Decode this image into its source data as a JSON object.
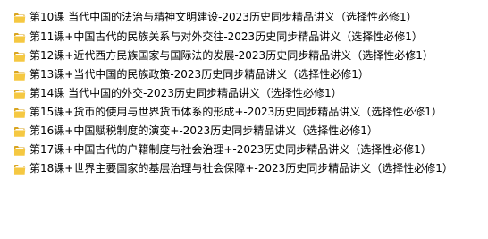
{
  "items": [
    {
      "name": "第10课 当代中国的法治与精神文明建设-2023历史同步精品讲义（选择性必修1）",
      "icon": "folder-icon"
    },
    {
      "name": "第11课+中国古代的民族关系与对外交往-2023历史同步精品讲义（选择性必修1）",
      "icon": "folder-icon"
    },
    {
      "name": "第12课+近代西方民族国家与国际法的发展-2023历史同步精品讲义（选择性必修1）",
      "icon": "folder-icon"
    },
    {
      "name": "第13课+当代中国的民族政策-2023历史同步精品讲义（选择性必修1）",
      "icon": "folder-icon"
    },
    {
      "name": "第14课 当代中国的外交-2023历史同步精品讲义（选择性必修1）",
      "icon": "folder-icon"
    },
    {
      "name": "第15课+货币的使用与世界货币体系的形成+-2023历史同步精品讲义（选择性必修1）",
      "icon": "folder-icon"
    },
    {
      "name": "第16课+中国赋税制度的演变+-2023历史同步精品讲义（选择性必修1）",
      "icon": "folder-icon"
    },
    {
      "name": "第17课+中国古代的户籍制度与社会治理+-2023历史同步精品讲义（选择性必修1）",
      "icon": "folder-icon"
    },
    {
      "name": "第18课+世界主要国家的基层治理与社会保障+-2023历史同步精品讲义（选择性必修1）",
      "icon": "folder-icon"
    }
  ],
  "colors": {
    "background": "#ffffff",
    "text": "#000000",
    "folder_front": "#F5C842",
    "folder_back": "#D9A521",
    "folder_page": "#FFFFFF"
  }
}
